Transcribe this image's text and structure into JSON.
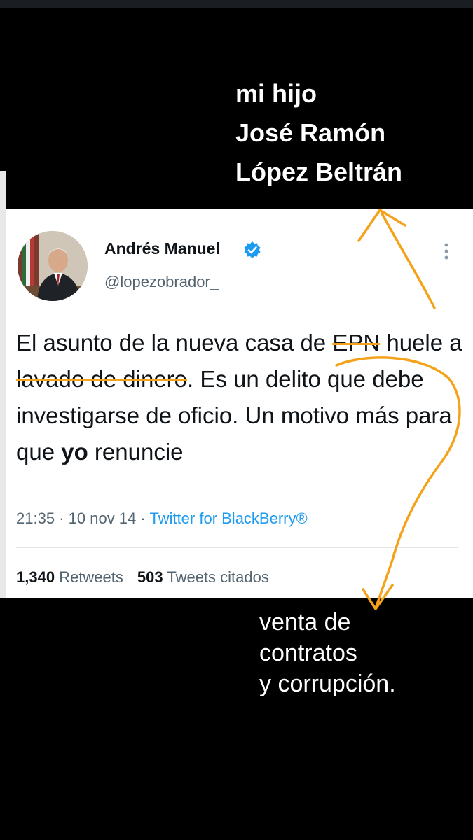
{
  "captions": {
    "top_lines": [
      "mi hijo",
      "José Ramón",
      "López Beltrán"
    ],
    "bottom_lines": [
      "venta de",
      "contratos",
      "y corrupción."
    ]
  },
  "tweet": {
    "display_name": "Andrés Manuel",
    "handle": "@lopezobrador_",
    "text_parts": {
      "p1": "El asunto de la nueva casa de ",
      "epn": "EPN",
      "p2": " huele a ",
      "lavado": "lavado de dinero",
      "p3": ". Es un delito que debe investigarse de oficio. Un motivo más para que ",
      "yo": "yo",
      "p4": " renuncie"
    },
    "time": "21:35",
    "date": "10 nov 14",
    "separator": "·",
    "source": "Twitter for BlackBerry®",
    "retweets_count": "1,340",
    "retweets_label": "Retweets",
    "quotes_count": "503",
    "quotes_label": "Tweets citados"
  },
  "icons": {
    "verified": "verified-badge-icon",
    "more": "more-vertical-icon"
  },
  "colors": {
    "annotation": "#f5a21b",
    "verified": "#1d9bf0",
    "link": "#1d9bf0",
    "secondary_text": "#536471"
  }
}
